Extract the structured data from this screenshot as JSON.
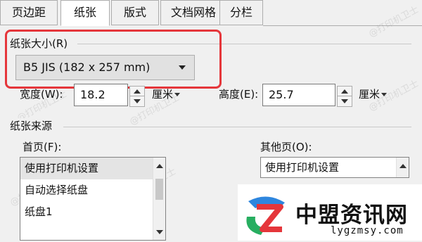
{
  "tabs": [
    {
      "label": "页边距",
      "active": false
    },
    {
      "label": "纸张",
      "active": true
    },
    {
      "label": "版式",
      "active": false
    },
    {
      "label": "文档网格",
      "active": false
    },
    {
      "label": "分栏",
      "active": false
    }
  ],
  "paper_size": {
    "group_label": "纸张大小(R)",
    "selected": "B5 JIS (182 x 257 mm)"
  },
  "width": {
    "label": "宽度(W):",
    "value": "18.2",
    "unit": "厘米"
  },
  "height": {
    "label": "高度(E):",
    "value": "25.7",
    "unit": "厘米"
  },
  "paper_source": {
    "group_label": "纸张来源",
    "first_page": {
      "label": "首页(F):",
      "items": [
        "使用打印机设置",
        "自动选择纸盘",
        "纸盘1"
      ]
    },
    "other_pages": {
      "label": "其他页(O):",
      "items": [
        "使用打印机设置"
      ]
    }
  },
  "watermark_text": "@打印机卫士",
  "logo": {
    "name": "中盟资讯网",
    "url": "lygzmsy.com",
    "colors": {
      "blue": "#2e86de",
      "green": "#27ae60",
      "red": "#e5363b"
    }
  },
  "colors": {
    "highlight_border": "#e5363b"
  }
}
